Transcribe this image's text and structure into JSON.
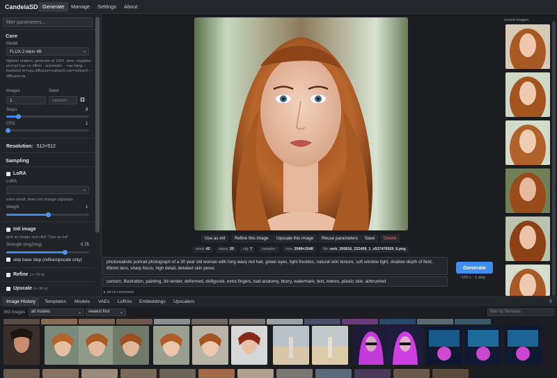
{
  "app": {
    "brand": "CandelaSD"
  },
  "nav": {
    "tabs": [
      "Generate",
      "Manage",
      "Settings",
      "About"
    ]
  },
  "left": {
    "filter_placeholder": "filter parameters...",
    "core_title": "Core",
    "model_label": "Model",
    "model_value": "FLUX.2-klein 4B",
    "model_hint": "highest realism; generate at 1024. slow; negative prompt has no effect · automatic: --vae-tiling --backend te=cpu,diffusion=vulkan0,vae=vulkan0 --diffusion-fa",
    "images_label": "Images",
    "images_value": "1",
    "seed_label": "Seed",
    "seed_placeholder": "random",
    "steps_label": "Steps",
    "steps_value": "8",
    "steps_level": 0.14,
    "cfg_label": "CFG",
    "cfg_value": "1",
    "cfg_level": 0.02,
    "resolution_label": "Resolution:",
    "resolution_value": "512×512",
    "sampling_title": "Sampling",
    "lora_title": "LoRA",
    "lora_label": "LoRA",
    "lora_hint": "extra detail, does not change cfg/steps",
    "weight_label": "Weight",
    "weight_value": "1",
    "weight_level": 0.5,
    "init_title": "Init image",
    "init_hint": "pick an image and click \"Use as init\"",
    "strength_label": "Strength (img2img)",
    "strength_value": "0.75",
    "strength_level": 0.71,
    "skip_label": "skip base step (refine/upscale only)",
    "refine_label": "Refine",
    "refine_note": "(+~70 s)",
    "upscale_label": "Upscale",
    "upscale_note": "(+~90 s)"
  },
  "actions": [
    "Use as init",
    "Refine this image",
    "Upscale this image",
    "Reuse parameters",
    "Save",
    "Delete"
  ],
  "meta": {
    "seed_key": "seed:",
    "seed": "42",
    "steps_key": "steps:",
    "steps": "20",
    "cfg_key": "cfg:",
    "cfg": "7",
    "sampler_key": "sampler:",
    "size_key": "size:",
    "size": "2048×2048",
    "file_key": "file:",
    "file": "web_260816_232408_1_s537476559_6.png"
  },
  "prompt": "photorealistic portrait photograph of a 30 year old woman with long wavy red hair, green eyes, light freckles, natural skin texture, soft window light, shallow depth of field, 85mm lens, sharp focus, high detail, detailed skin pores",
  "negative_prompt": "cartoon, illustration, painting, 3d render, deformed, disfigured, extra fingers, bad anatomy, blurry, watermark, text, lowres, plastic skin, airbrushed",
  "generate": {
    "label": "Generate",
    "eta": "~165 s · 1 step"
  },
  "sdcli": "▸ sd-cli command",
  "recent_title": "recent images",
  "bottom_tabs": [
    "Image History",
    "Templates",
    "Models",
    "VAEs",
    "LoRAs",
    "Embeddings",
    "Upscalers"
  ],
  "gallery": {
    "count": "363 images",
    "model_filter": "all models",
    "sort": "newest first",
    "filename_placeholder": "filter by filename..."
  },
  "colors": {
    "accent": "#3d8ef0",
    "danger": "#f07070",
    "bg": "#1b1d21"
  }
}
